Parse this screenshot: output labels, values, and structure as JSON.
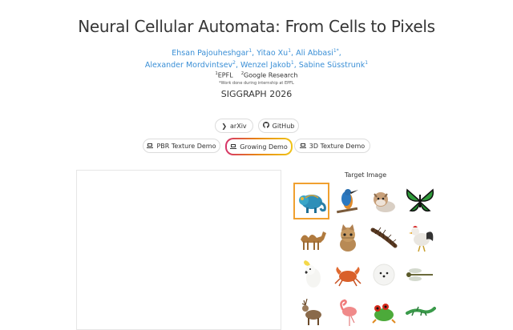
{
  "header": {
    "title": "Neural Cellular Automata: From Cells to Pixels",
    "authors_line1": [
      {
        "name": "Ehsan Pajouheshgar",
        "sup": "1"
      },
      {
        "name": "Yitao Xu",
        "sup": "1"
      },
      {
        "name": "Ali Abbasi",
        "sup": "1*"
      }
    ],
    "authors_line2": [
      {
        "name": "Alexander Mordvintsev",
        "sup": "2"
      },
      {
        "name": "Wenzel Jakob",
        "sup": "1"
      },
      {
        "name": "Sabine Süsstrunk",
        "sup": "1"
      }
    ],
    "affiliations": [
      {
        "sup": "1",
        "name": "EPFL"
      },
      {
        "sup": "2",
        "name": "Google Research"
      }
    ],
    "note": "*Work done during internship at EPFL",
    "venue": "SIGGRAPH 2026"
  },
  "links": {
    "arxiv": "arXiv",
    "github": "GitHub"
  },
  "demos": {
    "pbr": "PBR Texture Demo",
    "growing": "Growing Demo",
    "texture3d": "3D Texture Demo",
    "active": "growing"
  },
  "targets": {
    "title": "Target Image",
    "selected": "chameleon",
    "items": [
      "chameleon",
      "kingfisher",
      "bulldog",
      "butterfly",
      "camel",
      "kitten",
      "centipede",
      "rooster",
      "cockatoo",
      "crab",
      "pomeranian",
      "dragonfly",
      "reindeer",
      "flamingo",
      "tree-frog",
      "lizard"
    ]
  },
  "colors": {
    "link": "#3a8fd6",
    "active_gradient": [
      "#d6336c",
      "#e8890c",
      "#f0c419"
    ],
    "selected_border": "#f0a030"
  }
}
